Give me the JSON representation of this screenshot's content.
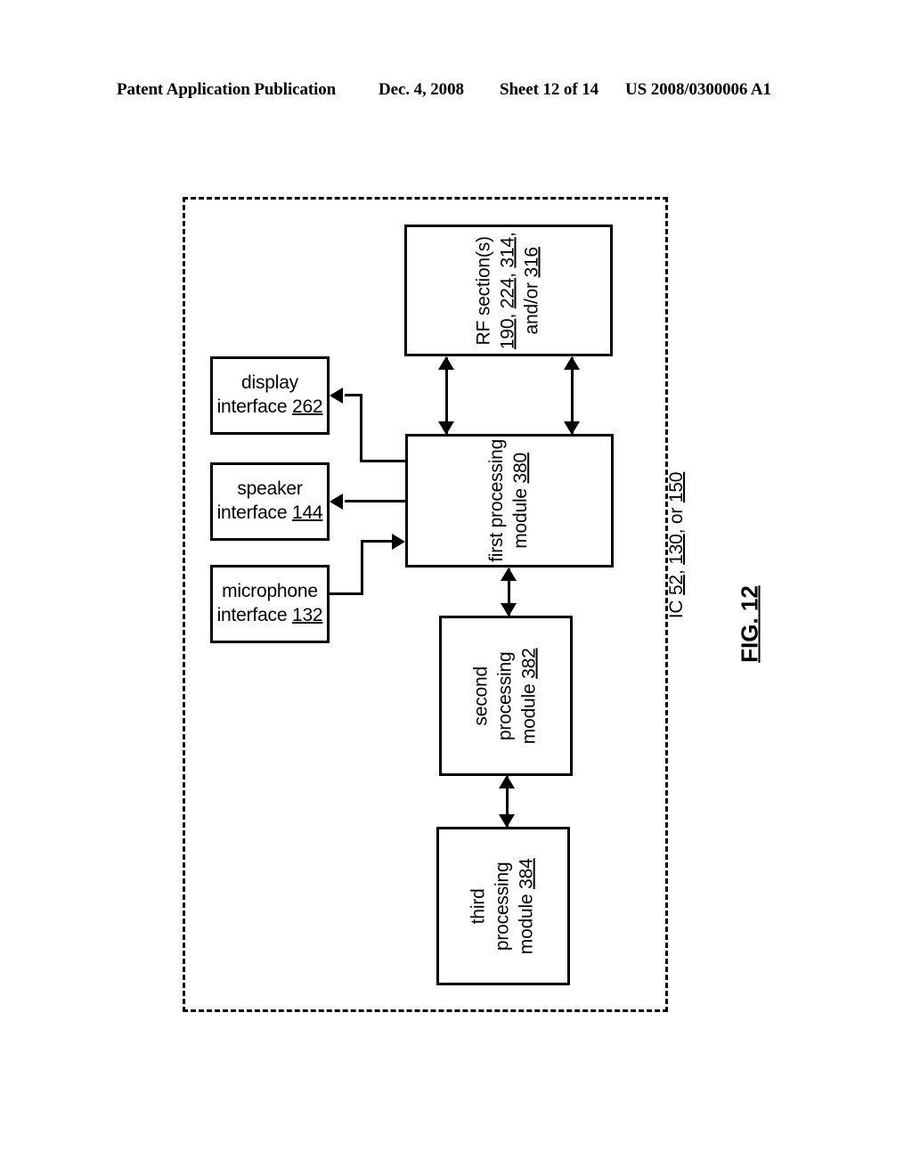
{
  "header": {
    "publication": "Patent Application Publication",
    "date": "Dec. 4, 2008",
    "sheet": "Sheet 12 of 14",
    "patent_number": "US 2008/0300006 A1"
  },
  "figure": {
    "caption": "FIG. 12",
    "boundary_label": "IC 52, 130, or 150",
    "boundary_label_plain": "IC 52, 130, or 150",
    "blocks": {
      "rf_section": {
        "line1": "RF section(s)",
        "line2": "190, 224, 314,",
        "line3": "and/or 316",
        "refs": [
          "190",
          "224",
          "314",
          "316"
        ]
      },
      "display_interface": {
        "line1": "display",
        "line2": "interface",
        "ref": "262"
      },
      "speaker_interface": {
        "line1": "speaker",
        "line2": "interface",
        "ref": "144"
      },
      "microphone_interface": {
        "line1": "microphone",
        "line2": "interface",
        "ref": "132"
      },
      "first_processing_module": {
        "line1": "first processing",
        "line2": "module",
        "ref": "380"
      },
      "second_processing_module": {
        "line1": "second",
        "line2": "processing",
        "line3": "module",
        "ref": "382"
      },
      "third_processing_module": {
        "line1": "third processing",
        "line2": "module",
        "ref": "384"
      }
    },
    "ic_refs": [
      "52",
      "130",
      "150"
    ]
  }
}
